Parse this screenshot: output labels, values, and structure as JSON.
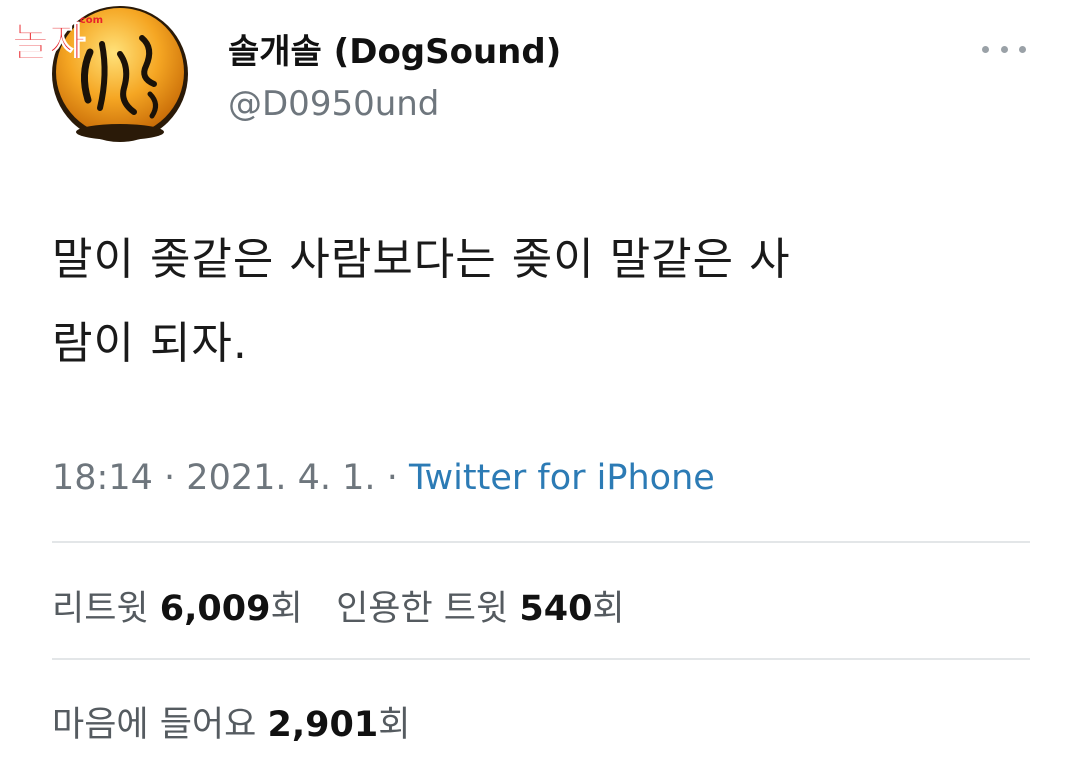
{
  "watermark": {
    "text": "놀자",
    "domain": ".com"
  },
  "profile": {
    "display_name": "솔개솔 (DogSound)",
    "handle": "@D0950und"
  },
  "tweet": {
    "line1": "말이 좆같은 사람보다는 좆이 말같은 사",
    "line2": "람이 되자."
  },
  "meta": {
    "time": "18:14",
    "separator": "·",
    "date": "2021. 4. 1.",
    "source": "Twitter for iPhone"
  },
  "stats": {
    "retweets_label": "리트윗",
    "retweets_count": "6,009",
    "retweets_unit": "회",
    "quotes_label": "인용한 트윗",
    "quotes_count": "540",
    "quotes_unit": "회",
    "likes_label": "마음에 들어요",
    "likes_count": "2,901",
    "likes_unit": "회"
  },
  "colors": {
    "avatar_orange": "#f0a21a",
    "source_link": "#2c7bb5",
    "watermark_red": "#e8232a",
    "muted_text": "#6e767d"
  }
}
